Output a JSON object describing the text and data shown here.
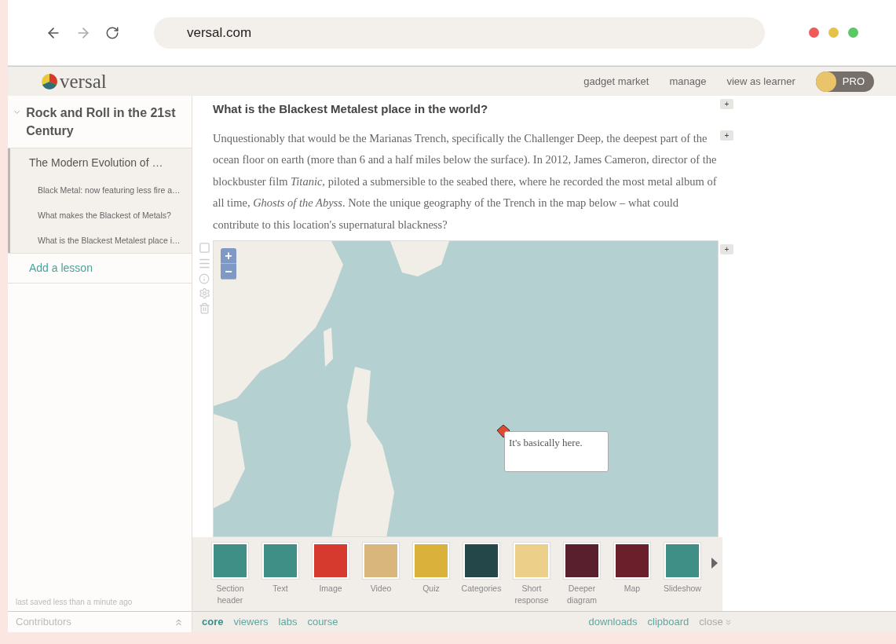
{
  "browser": {
    "url": "versal.com"
  },
  "header": {
    "logo": "versal",
    "nav": [
      "gadget market",
      "manage",
      "view as learner"
    ],
    "badge": "PRO"
  },
  "sidebar": {
    "course": {
      "title": "Rock and Roll in the 21st Century",
      "expanded": true
    },
    "lessons": [
      {
        "title": "The Modern Evolution of …",
        "selected": true,
        "children": [
          {
            "title": "Black Metal: now featuring less fire a…"
          },
          {
            "title": "What makes the Blackest of Metals?"
          },
          {
            "title": "What is the Blackest Metalest place i…"
          }
        ]
      }
    ],
    "add_lesson": "Add a lesson",
    "saved": "last saved less than a minute ago",
    "contributors": "Contributors"
  },
  "content": {
    "heading": "What is the Blackest Metalest place in the world?",
    "paragraph": "Unquestionably that would be the Marianas Trench, specifically the Challenger Deep, the deepest part of the ocean floor on earth (more than 6 and a half miles below the surface). In 2012, James Cameron, director of the blockbuster film *Titanic,* piloted a submersible to the seabed there, where he recorded the most metal album of all time, *Ghosts of the Abyss*. Note the unique geography of the Trench in the map below – what could contribute to this location's supernatural blackness?",
    "add_buttons": [
      "+",
      "+",
      "+"
    ],
    "map": {
      "zoom": [
        "+",
        "−"
      ],
      "popup": "It's basically here."
    }
  },
  "gadgets": [
    {
      "label": "Section header",
      "color": "#3f8f86"
    },
    {
      "label": "Text",
      "color": "#3f8f86"
    },
    {
      "label": "Image",
      "color": "#d63a2f"
    },
    {
      "label": "Video",
      "color": "#d9b77c"
    },
    {
      "label": "Quiz",
      "color": "#d9b13b"
    },
    {
      "label": "Categories",
      "color": "#24484a"
    },
    {
      "label": "Short response",
      "color": "#ecd089"
    },
    {
      "label": "Deeper diagram",
      "color": "#5a1f2c"
    },
    {
      "label": "Map",
      "color": "#6b1f2b"
    },
    {
      "label": "Slideshow",
      "color": "#3f8f86"
    }
  ],
  "tray_tabs": [
    {
      "label": "core",
      "selected": true
    },
    {
      "label": "viewers",
      "selected": false
    },
    {
      "label": "labs",
      "selected": false
    },
    {
      "label": "course",
      "selected": false
    }
  ],
  "tray_links": [
    "downloads",
    "clipboard"
  ],
  "close": "close"
}
